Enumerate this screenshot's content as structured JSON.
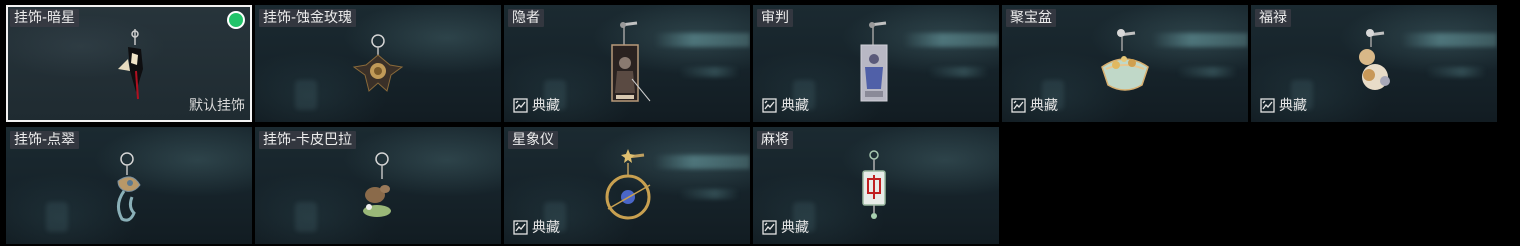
{
  "items": [
    {
      "name": "挂饰-暗星",
      "selected": true,
      "equipped": true,
      "footer": "默认挂饰"
    },
    {
      "name": "挂饰-蚀金玫瑰",
      "selected": false,
      "equipped": false,
      "footer": ""
    },
    {
      "name": "隐者",
      "selected": false,
      "equipped": false,
      "footer": "典藏"
    },
    {
      "name": "审判",
      "selected": false,
      "equipped": false,
      "footer": "典藏"
    },
    {
      "name": "聚宝盆",
      "selected": false,
      "equipped": false,
      "footer": "典藏"
    },
    {
      "name": "福禄",
      "selected": false,
      "equipped": false,
      "footer": "典藏"
    },
    {
      "name": "挂饰-点翠",
      "selected": false,
      "equipped": false,
      "footer": ""
    },
    {
      "name": "挂饰-卡皮巴拉",
      "selected": false,
      "equipped": false,
      "footer": ""
    },
    {
      "name": "星象仪",
      "selected": false,
      "equipped": false,
      "footer": "典藏"
    },
    {
      "name": "麻将",
      "selected": false,
      "equipped": false,
      "footer": "典藏"
    }
  ],
  "icons": {
    "collection": "collection-icon",
    "equipped": "equipped-dot-icon"
  },
  "colors": {
    "equipped_dot": "#22c46a",
    "selected_border": "#f2f2f2",
    "tag_background": "#3c3c46"
  }
}
